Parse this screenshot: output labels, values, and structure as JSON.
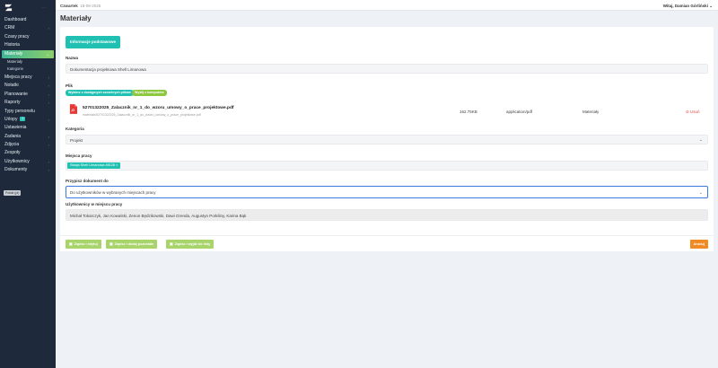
{
  "sidebar": {
    "logo_icon": "brand-logo-icon",
    "logo_right": "......",
    "items": [
      {
        "label": "Dashboard",
        "chevron": false
      },
      {
        "label": "CRM",
        "chevron": true
      },
      {
        "label": "Czasy pracy",
        "chevron": false
      },
      {
        "label": "Historia",
        "chevron": false
      },
      {
        "label": "Materiały",
        "chevron": true,
        "active": true
      },
      {
        "label": "Materiały",
        "sub": true
      },
      {
        "label": "Kategorie",
        "sub": true
      },
      {
        "label": "Miejsca pracy",
        "chevron": true
      },
      {
        "label": "Notatki",
        "chevron": true
      },
      {
        "label": "Planowanie",
        "chevron": true
      },
      {
        "label": "Raporty",
        "chevron": true
      },
      {
        "label": "Typy personelu",
        "chevron": false
      },
      {
        "label": "Urlopy",
        "chevron": true,
        "badge": "1"
      },
      {
        "label": "Ustawienia",
        "chevron": false
      },
      {
        "label": "Zadania",
        "chevron": true
      },
      {
        "label": "Zdjęcia",
        "chevron": true
      },
      {
        "label": "Zespoły",
        "chevron": false
      },
      {
        "label": "Użytkownicy",
        "chevron": true
      },
      {
        "label": "Dokumenty",
        "chevron": true
      }
    ],
    "footer_tag": "Polski (pl)"
  },
  "topbar": {
    "day": "Czwartek",
    "date": "18-09-2025",
    "user": "Witaj, Damian Górliński"
  },
  "page_title": "Materiały",
  "card": {
    "tab_label": "Informacje podstawowe",
    "name_label": "Nazwa",
    "name_value": "Dokumentacja projektowa Shell Limanowa",
    "file_label": "Plik",
    "file_pill_1": "Wybierz z dostępnych szczelnych plików",
    "file_pill_2": "Wyślij z komputera",
    "file": {
      "icon": "pdf-file-icon",
      "name": "52701322025_Zalacznik_nr_1_do_wzoru_umowy_o_prace_projektowe.pdf",
      "path": "materials/52701322025_Zalacznik_nr_1_do_wzoru_umowy_o_prace_projektowe.pdf",
      "size": "162.75KB",
      "mime": "application/pdf",
      "category": "Materiały",
      "delete_label": "Usuń"
    },
    "category_label": "Kategoria",
    "category_value": "Projekt",
    "workplace_label": "Miejsca pracy",
    "workplace_chip": "Stacja Shell Limanowa #8128",
    "assign_label": "Przypisz dokument do",
    "assign_value": "Do użytkowników w wybranych miejscach pracy",
    "users_label": "Użytkownicy w miejscu pracy",
    "users_value": "Michał Tokarczyk, Jan Kowalski, Zenon Będzikowski, Dawi Grenda, Augustyn Porkiliny, Karina Bąk"
  },
  "footer": {
    "save_edit": "Zapisz i edytuj",
    "save_add": "Zapisz i dodaj pozostałe",
    "save_exit": "Zapisz i wyjdź do listy",
    "cancel": "Anuluj"
  }
}
